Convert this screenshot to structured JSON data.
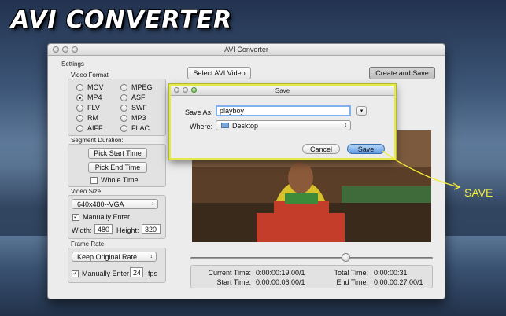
{
  "promo": {
    "title": "AVI CONVERTER",
    "annotation": "SAVE"
  },
  "window": {
    "title": "AVI Converter"
  },
  "settings": {
    "label": "Settings",
    "video_format": {
      "label": "Video Format",
      "options": [
        {
          "label": "MOV",
          "selected": false
        },
        {
          "label": "MPEG",
          "selected": false
        },
        {
          "label": "MP4",
          "selected": true
        },
        {
          "label": "ASF",
          "selected": false
        },
        {
          "label": "FLV",
          "selected": false
        },
        {
          "label": "SWF",
          "selected": false
        },
        {
          "label": "RM",
          "selected": false
        },
        {
          "label": "MP3",
          "selected": false
        },
        {
          "label": "AIFF",
          "selected": false
        },
        {
          "label": "FLAC",
          "selected": false
        }
      ]
    },
    "segment": {
      "label": "Segment Duration:",
      "pick_start": "Pick Start Time",
      "pick_end": "Pick End Time",
      "whole_time": "Whole Time",
      "whole_time_checked": false
    },
    "video_size": {
      "label": "Video Size",
      "selected": "640x480--VGA",
      "manually_enter": "Manually Enter",
      "manually_checked": true,
      "width_label": "Width:",
      "width_value": "480",
      "height_label": "Height:",
      "height_value": "320"
    },
    "frame_rate": {
      "label": "Frame Rate",
      "selected": "Keep Original Rate",
      "manually_enter": "Manually Enter",
      "manually_checked": true,
      "fps_value": "24",
      "fps_label": "fps"
    }
  },
  "toolbar": {
    "select_video": "Select AVI Video",
    "create_save": "Create and Save"
  },
  "player": {
    "progress": 0.64
  },
  "times": {
    "current_label": "Current Time:",
    "current_value": "0:00:00:19.00/1",
    "start_label": "Start Time:",
    "start_value": "0:00:00:06.00/1",
    "total_label": "Total Time:",
    "total_value": "0:00:00:31",
    "end_label": "End Time:",
    "end_value": "0:00:00:27.00/1"
  },
  "save_dialog": {
    "title": "Save",
    "save_as_label": "Save As:",
    "filename": "playboy",
    "where_label": "Where:",
    "where_value": "Desktop",
    "cancel": "Cancel",
    "save": "Save"
  },
  "colors": {
    "highlight": "#e5e84a",
    "accent_button": "#6fa8e8"
  }
}
